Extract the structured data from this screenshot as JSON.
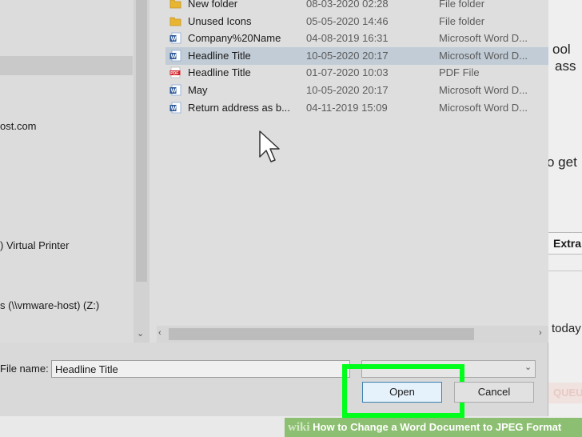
{
  "background": {
    "snippets": [
      "ool",
      "ass",
      "o get",
      "today"
    ],
    "extra_label": "Extra",
    "queue_label": "QUEUE"
  },
  "nav": {
    "items": [
      "ost.com",
      ") Virtual Printer",
      "s (\\\\vmware-host) (Z:)"
    ],
    "scroll_down_icon": "chevron-down"
  },
  "files": [
    {
      "name": "New folder",
      "date": "08-03-2020 02:28",
      "type": "File folder",
      "icon": "folder"
    },
    {
      "name": "Unused Icons",
      "date": "05-05-2020 14:46",
      "type": "File folder",
      "icon": "folder"
    },
    {
      "name": "Company%20Name",
      "date": "04-08-2019 16:31",
      "type": "Microsoft Word D...",
      "icon": "word"
    },
    {
      "name": "Headline Title",
      "date": "10-05-2020 20:17",
      "type": "Microsoft Word D...",
      "icon": "word",
      "selected": true
    },
    {
      "name": "Headline Title",
      "date": "01-07-2020 10:03",
      "type": "PDF File",
      "icon": "pdf"
    },
    {
      "name": "May",
      "date": "10-05-2020 20:17",
      "type": "Microsoft Word D...",
      "icon": "word"
    },
    {
      "name": "Return address as b...",
      "date": "04-11-2019 15:09",
      "type": "Microsoft Word D...",
      "icon": "word"
    }
  ],
  "footer": {
    "filename_label": "File name:",
    "filename_value": "Headline Title",
    "open_label": "Open",
    "cancel_label": "Cancel"
  },
  "banner": {
    "wiki": "wiki",
    "title": "How to Change a Word Document to JPEG Format"
  },
  "colors": {
    "highlight": "#00ff1a",
    "selection": "#c1ccd6",
    "banner": "#8dbf72"
  }
}
